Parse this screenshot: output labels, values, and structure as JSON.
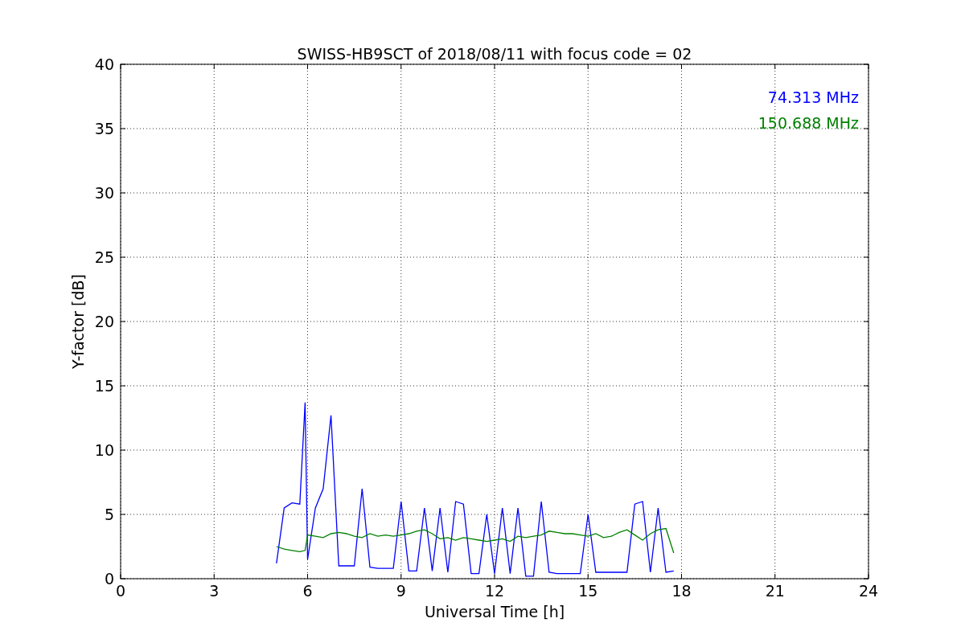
{
  "figure": {
    "chart_data": {
      "type": "line",
      "title": "SWISS-HB9SCT of 2018/08/11 with focus code = 02",
      "xlabel": "Universal Time [h]",
      "ylabel": "Y-factor [dB]",
      "x": [
        5,
        5.25,
        5.5,
        5.75,
        5.92,
        6,
        6.25,
        6.5,
        6.75,
        7,
        7.25,
        7.5,
        7.75,
        8,
        8.25,
        8.5,
        8.75,
        9,
        9.25,
        9.5,
        9.75,
        10,
        10.25,
        10.5,
        10.75,
        11,
        11.25,
        11.5,
        11.75,
        12,
        12.25,
        12.5,
        12.75,
        13,
        13.25,
        13.5,
        13.75,
        14,
        14.25,
        14.5,
        14.75,
        15,
        15.25,
        15.5,
        15.75,
        16,
        16.25,
        16.5,
        16.75,
        17,
        17.25,
        17.5,
        17.75
      ],
      "series": [
        {
          "name": "74.313 MHz",
          "color": "#0000ff",
          "values": [
            1.2,
            5.5,
            5.9,
            5.8,
            13.7,
            1.5,
            5.5,
            7.0,
            12.7,
            1.0,
            1.0,
            1.0,
            7.0,
            0.9,
            0.8,
            0.8,
            0.8,
            6.0,
            0.6,
            0.6,
            5.5,
            0.6,
            5.5,
            0.5,
            6.0,
            5.8,
            0.4,
            0.4,
            5.0,
            0.4,
            5.5,
            0.4,
            5.5,
            0.2,
            0.2,
            6.0,
            0.5,
            0.4,
            0.4,
            0.4,
            0.4,
            5.0,
            0.5,
            0.5,
            0.5,
            0.5,
            0.5,
            5.8,
            6.0,
            0.5,
            5.5,
            0.5,
            0.6
          ]
        },
        {
          "name": "150.688 MHz",
          "color": "#008000",
          "values": [
            2.5,
            2.3,
            2.2,
            2.1,
            2.2,
            3.4,
            3.3,
            3.2,
            3.5,
            3.6,
            3.5,
            3.3,
            3.2,
            3.5,
            3.3,
            3.4,
            3.3,
            3.4,
            3.5,
            3.7,
            3.8,
            3.5,
            3.1,
            3.2,
            3.0,
            3.2,
            3.1,
            3.0,
            2.9,
            3.0,
            3.1,
            2.9,
            3.3,
            3.2,
            3.3,
            3.4,
            3.7,
            3.6,
            3.5,
            3.5,
            3.4,
            3.3,
            3.5,
            3.2,
            3.3,
            3.6,
            3.8,
            3.4,
            3.0,
            3.5,
            3.8,
            3.9,
            2.0
          ]
        }
      ],
      "xlim": [
        0,
        24
      ],
      "ylim": [
        0,
        40
      ],
      "xticks": [
        0,
        3,
        6,
        9,
        12,
        15,
        18,
        21,
        24
      ],
      "yticks": [
        0,
        5,
        10,
        15,
        20,
        25,
        30,
        35,
        40
      ],
      "grid": true
    }
  }
}
